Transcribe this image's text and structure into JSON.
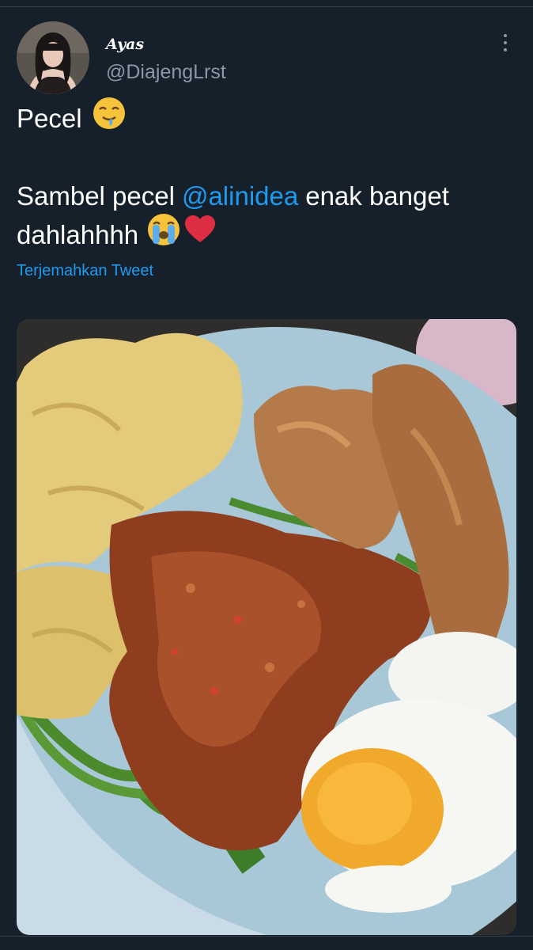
{
  "tweet": {
    "author": {
      "display_name": "Ayas",
      "handle": "@DiajengLrst"
    },
    "text": {
      "line1_word": "Pecel",
      "line2_prefix": "Sambel pecel",
      "mention": "@alinidea",
      "line2_suffix": "enak banget",
      "line3_word": "dahlahhhh"
    },
    "emojis": [
      "drooling-face",
      "loudly-crying-face",
      "red-heart"
    ],
    "translate_label": "Terjemahkan Tweet",
    "media": {
      "icon": "photo-food-pecel"
    }
  },
  "colors": {
    "background": "#15202b",
    "link": "#1d9bf0",
    "secondary_text": "#8b98a5",
    "divider": "#38444d"
  }
}
